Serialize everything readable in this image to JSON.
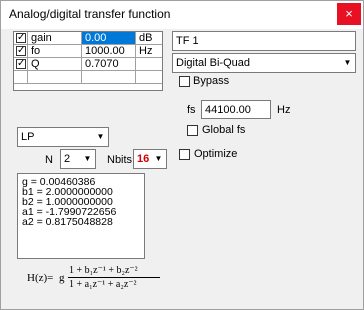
{
  "window": {
    "title": "Analog/digital transfer function",
    "close_label": "×"
  },
  "params": [
    {
      "checked": true,
      "name": "gain",
      "value": "0.00",
      "unit": "dB",
      "selected": true
    },
    {
      "checked": true,
      "name": "fo",
      "value": "1000.00",
      "unit": "Hz",
      "selected": false
    },
    {
      "checked": true,
      "name": "Q",
      "value": "0.7070",
      "unit": "",
      "selected": false
    }
  ],
  "tf_name": "TF 1",
  "filter_impl": "Digital Bi-Quad",
  "bypass_label": "Bypass",
  "fs": {
    "label": "fs",
    "value": "44100.00",
    "unit": "Hz"
  },
  "global_fs_label": "Global fs",
  "filter_type": "LP",
  "n": {
    "label": "N",
    "value": "2"
  },
  "nbits": {
    "label": "Nbits",
    "value": "16"
  },
  "optimize_label": "Optimize",
  "coefficients": [
    "g = 0.00460386",
    "b1 = 2.0000000000",
    "b2 = 1.0000000000",
    "a1 = -1.7990722656",
    "a2 = 0.8175048828"
  ],
  "formula": {
    "lhs": "H(z)=",
    "g": "g",
    "numerator": "1 + b₁z⁻¹ + b₂z⁻²",
    "denominator": "1 + a₁z⁻¹ + a₂z⁻²"
  }
}
